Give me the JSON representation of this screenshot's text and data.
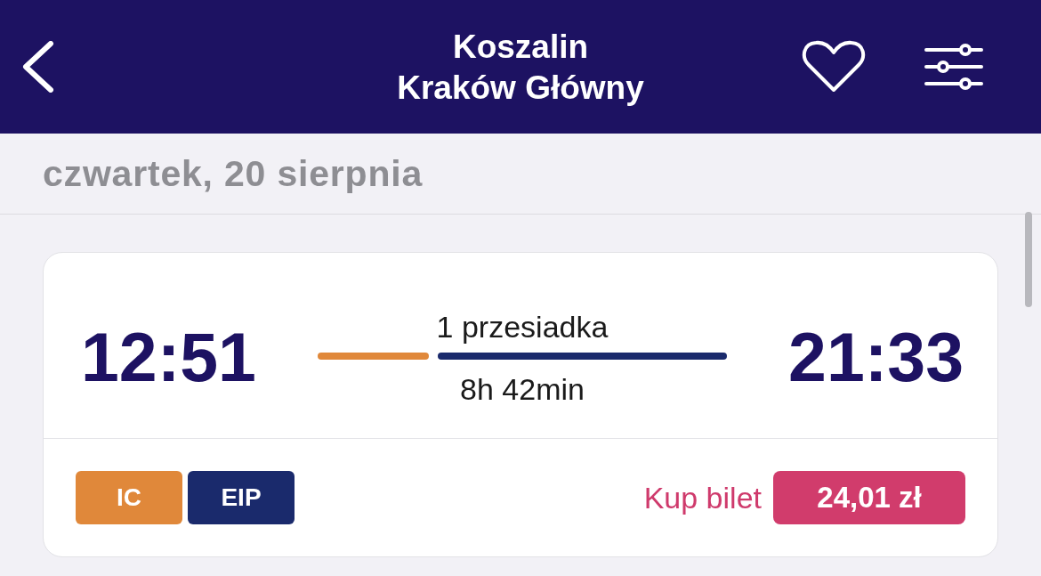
{
  "header": {
    "origin": "Koszalin",
    "destination": "Kraków Główny",
    "favorite": false
  },
  "date": "czwartek, 20 sierpnia",
  "connections": [
    {
      "departure": "12:51",
      "arrival": "21:33",
      "transfers": "1 przesiadka",
      "duration": "8h 42min",
      "trains": [
        {
          "name": "IC",
          "color": "#e0883a"
        },
        {
          "name": "EIP",
          "color": "#1a2a6c"
        }
      ],
      "buy_label": "Kup bilet",
      "price": "24,01 zł"
    }
  ]
}
